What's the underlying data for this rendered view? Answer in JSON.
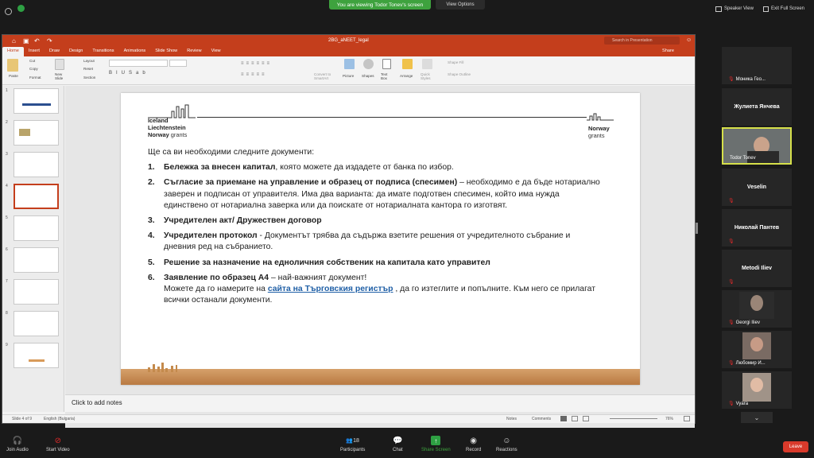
{
  "zoom": {
    "viewing_banner": "You are viewing Todor Tonev's screen",
    "view_options": "View Options",
    "speaker_view": "Speaker View",
    "exit_full_screen": "Exit Full Screen",
    "bottom": {
      "join_audio": "Join Audio",
      "start_video": "Start Video",
      "participants": "Participants",
      "participants_count": "18",
      "chat": "Chat",
      "share_screen": "Share Screen",
      "record": "Record",
      "reactions": "Reactions",
      "leave": "Leave"
    },
    "participants": [
      {
        "name": "Моника Гео...",
        "type": "name-only-bottom",
        "muted": true
      },
      {
        "name": "Жулиета Янчева",
        "type": "center",
        "muted": false
      },
      {
        "name": "Todor Tonev",
        "type": "video-active",
        "muted": false
      },
      {
        "name": "Veselin",
        "type": "center",
        "muted": true
      },
      {
        "name": "Николай Пантев",
        "type": "center",
        "muted": true
      },
      {
        "name": "Metodi Iliev",
        "type": "center",
        "muted": true
      },
      {
        "name": "Georgi Iliev",
        "type": "video",
        "muted": true
      },
      {
        "name": "Любомир И...",
        "type": "video",
        "muted": true
      },
      {
        "name": "Vyara",
        "type": "video",
        "muted": true
      }
    ]
  },
  "ppt": {
    "file_title": "2BG_aNEET_legal",
    "search_placeholder": "Search in Presentation",
    "share": "Share",
    "tabs": [
      "Home",
      "Insert",
      "Draw",
      "Design",
      "Transitions",
      "Animations",
      "Slide Show",
      "Review",
      "View"
    ],
    "ribbon": {
      "paste": "Paste",
      "cut": "Cut",
      "copy": "Copy",
      "format": "Format",
      "new_slide": "New Slide",
      "layout": "Layout",
      "reset": "Reset",
      "section": "Section",
      "convert": "Convert to SmartArt",
      "picture": "Picture",
      "shapes": "Shapes",
      "text_box": "Text Box",
      "arrange": "Arrange",
      "quick_styles": "Quick Styles",
      "shape_fill": "Shape Fill",
      "shape_outline": "Shape Outline"
    },
    "notes_placeholder": "Click to add notes",
    "status": {
      "slide": "Slide 4 of 9",
      "language": "English (Bulgaria)",
      "notes": "Notes",
      "comments": "Comments",
      "zoom": "76%"
    },
    "thumbnail_numbers": [
      "1",
      "2",
      "3",
      "4",
      "5",
      "6",
      "7",
      "8",
      "9"
    ],
    "selected_slide": 4
  },
  "slide": {
    "logo_left": [
      "Iceland",
      "Liechtenstein",
      "Norway"
    ],
    "logo_left_suffix": "grants",
    "logo_right": "Norway",
    "logo_right_suffix": "grants",
    "intro": "Ще са ви необходими следните документи:",
    "items": [
      {
        "num": "1.",
        "bold": "Бележка за внесен капитал",
        "rest": ", която можете да издадете от банка по избор."
      },
      {
        "num": "2.",
        "bold": "Съгласие за приемане на управление и образец от подписа (спесимен)",
        "rest": " – необходимо е да бъде нотариално заверен и подписан от управителя. Има два варианта: да имате подготвен спесимен, който има нужда единствено от нотариална заверка или да поискате от нотариалната кантора го изготвят."
      },
      {
        "num": "3.",
        "bold": "Учредителен акт/ Дружествен договор",
        "rest": ""
      },
      {
        "num": "4.",
        "bold": "Учредителен протокол",
        "rest": " - Документът трябва да съдържа взетите решения от учредителното събрание и дневния ред на събранието."
      },
      {
        "num": "5.",
        "bold": "Решение за назначение на едноличния собственик на капитала като управител",
        "rest": ""
      },
      {
        "num": "6.",
        "bold": "Заявление по образец А4",
        "rest": " – най-важният документ!"
      }
    ],
    "item6_line2_pre": "Можете да го намерите на ",
    "item6_link": "сайта на Търговския регистър",
    "item6_line2_post": " , да го изтеглите и попълните. Към него се прилагат всички останали документи."
  }
}
